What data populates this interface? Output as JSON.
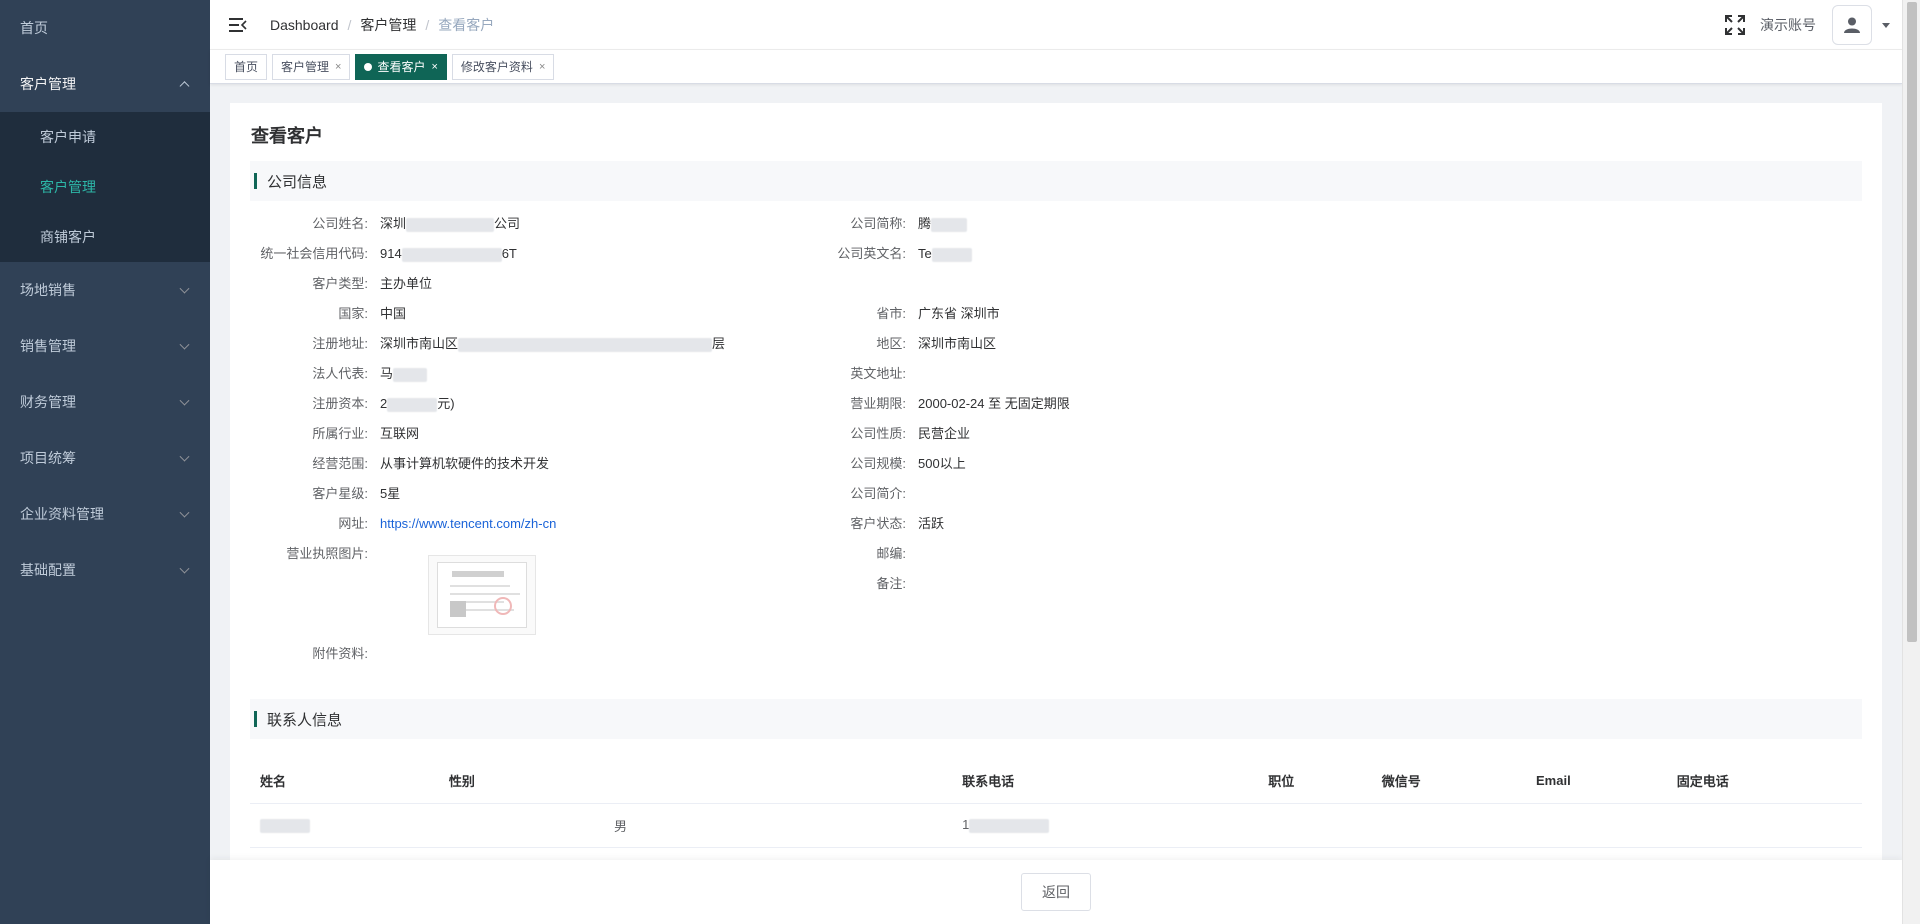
{
  "sidebar": {
    "items": [
      {
        "label": "首页"
      },
      {
        "label": "客户管理",
        "children": [
          {
            "label": "客户申请"
          },
          {
            "label": "客户管理"
          },
          {
            "label": "商铺客户"
          }
        ]
      },
      {
        "label": "场地销售"
      },
      {
        "label": "销售管理"
      },
      {
        "label": "财务管理"
      },
      {
        "label": "项目统筹"
      },
      {
        "label": "企业资料管理"
      },
      {
        "label": "基础配置"
      }
    ]
  },
  "navbar": {
    "breadcrumb": [
      "Dashboard",
      "客户管理",
      "查看客户"
    ],
    "separator": "/",
    "account_name": "演示账号"
  },
  "tags": [
    {
      "label": "首页",
      "active": false
    },
    {
      "label": "客户管理",
      "close": "×",
      "active": false
    },
    {
      "label": "查看客户",
      "close": "×",
      "active": true
    },
    {
      "label": "修改客户资料",
      "close": "×",
      "active": false
    }
  ],
  "page": {
    "title": "查看客户",
    "company_section": "公司信息",
    "contact_section": "联系人信息"
  },
  "company": {
    "left": [
      {
        "label": "公司姓名:",
        "value_pre": "深圳",
        "value_post": "公司"
      },
      {
        "label": "统一社会信用代码:",
        "value_pre": "914",
        "value_post": "6T"
      },
      {
        "label": "客户类型:",
        "value": "主办单位"
      },
      {
        "label": "国家:",
        "value": "中国"
      },
      {
        "label": "注册地址:",
        "value_pre": "深圳市南山区",
        "value_post": "层"
      },
      {
        "label": "法人代表:",
        "value_pre": "马",
        "value_post": ""
      },
      {
        "label": "注册资本:",
        "value_pre": "2",
        "value_post": "元)"
      },
      {
        "label": "所属行业:",
        "value": "互联网"
      },
      {
        "label": "经营范围:",
        "value": "从事计算机软硬件的技术开发"
      },
      {
        "label": "客户星级:",
        "value": "5星"
      },
      {
        "label": "网址:",
        "value": "https://www.tencent.com/zh-cn"
      },
      {
        "label": "营业执照图片:",
        "value": ""
      },
      {
        "label": "附件资料:",
        "value": ""
      }
    ],
    "right": [
      {
        "label": "公司简称:",
        "value_pre": "腾",
        "value_post": ""
      },
      {
        "label": "公司英文名:",
        "value_pre": "Te",
        "value_post": ""
      },
      {
        "label": "省市:",
        "value": "广东省 深圳市"
      },
      {
        "label": "地区:",
        "value": "深圳市南山区"
      },
      {
        "label": "英文地址:",
        "value": ""
      },
      {
        "label": "营业期限:",
        "value": "2000-02-24 至 无固定期限"
      },
      {
        "label": "公司性质:",
        "value": "民营企业"
      },
      {
        "label": "公司规模:",
        "value": "500以上"
      },
      {
        "label": "公司简介:",
        "value": ""
      },
      {
        "label": "客户状态:",
        "value": "活跃"
      },
      {
        "label": "邮编:",
        "value": ""
      },
      {
        "label": "备注:",
        "value": ""
      }
    ]
  },
  "contacts": {
    "columns": [
      "姓名",
      "性别",
      "联系电话",
      "职位",
      "微信号",
      "Email",
      "固定电话"
    ],
    "rows": [
      {
        "name": "",
        "gender": "男",
        "phone": "1",
        "position": "",
        "wechat": "",
        "email": "",
        "landline": ""
      }
    ]
  },
  "footer": {
    "back_label": "返回"
  },
  "colors": {
    "sidebar_bg": "#304156",
    "submenu_bg": "#1f2d3d",
    "active_text": "#2db7a8",
    "accent": "#0f6556",
    "link": "#1a63d8"
  }
}
